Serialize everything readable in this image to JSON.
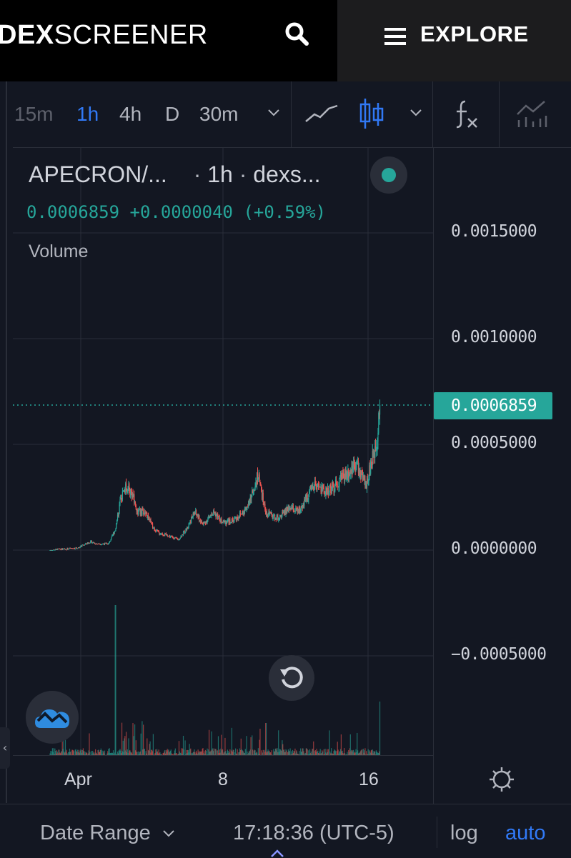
{
  "header": {
    "logo_bold": "DEX",
    "logo_light": "SCREENER",
    "explore_label": "EXPLORE"
  },
  "toolbar": {
    "timeframes": [
      "15m",
      "1h",
      "4h",
      "D",
      "30m"
    ],
    "active_timeframe": "1h"
  },
  "legend": {
    "symbol": "APECRON/...",
    "sep1": "·",
    "interval": "1h",
    "sep2": "·",
    "source": "dexs...",
    "price": "0.0006859",
    "change": "+0.0000040",
    "change_pct": "(+0.59%)",
    "volume_label": "Volume"
  },
  "price_axis": {
    "labels": [
      "0.0015000",
      "0.0010000",
      "0.0005000",
      "0.0000000",
      "−0.0005000"
    ],
    "current_price_tag": "0.0006859"
  },
  "time_axis": {
    "labels": [
      "Apr",
      "8",
      "16"
    ]
  },
  "bottom_bar": {
    "date_range_label": "Date Range",
    "clock": "17:18:36 (UTC-5)",
    "log_label": "log",
    "auto_label": "auto"
  },
  "colors": {
    "up": "#26a69a",
    "down": "#ef5350",
    "accent": "#3179f5",
    "background": "#131722"
  },
  "chart_data": {
    "type": "candlestick",
    "title": "APECRON/... · 1h · dexs...",
    "ylim": [
      -0.00085,
      0.0016
    ],
    "xlabel": "",
    "ylabel": "",
    "x_ticks": [
      "Apr",
      "8",
      "16"
    ],
    "last_price": 0.0006859,
    "price_path": [
      [
        0.0,
        0.0
      ],
      [
        2.0,
        1e-05
      ],
      [
        3.0,
        4e-05
      ],
      [
        3.4,
        3e-05
      ],
      [
        4.3,
        3e-05
      ],
      [
        4.8,
        0.0001
      ],
      [
        5.2,
        0.00025
      ],
      [
        5.6,
        0.0003
      ],
      [
        6.0,
        0.00027
      ],
      [
        6.4,
        0.00018
      ],
      [
        7.0,
        0.00018
      ],
      [
        7.6,
        0.0001
      ],
      [
        8.0,
        8e-05
      ],
      [
        8.6,
        7e-05
      ],
      [
        9.4,
        5e-05
      ],
      [
        10.0,
        0.0001
      ],
      [
        10.6,
        0.00018
      ],
      [
        11.2,
        0.00012
      ],
      [
        12.0,
        0.00018
      ],
      [
        12.6,
        0.00013
      ],
      [
        13.4,
        0.00014
      ],
      [
        14.0,
        0.00017
      ],
      [
        14.6,
        0.00022
      ],
      [
        15.2,
        0.00036
      ],
      [
        15.8,
        0.00018
      ],
      [
        16.6,
        0.00015
      ],
      [
        17.6,
        0.0002
      ],
      [
        18.2,
        0.00018
      ],
      [
        18.8,
        0.00025
      ],
      [
        19.4,
        0.0003
      ],
      [
        20.2,
        0.00028
      ],
      [
        20.8,
        0.0003
      ],
      [
        21.4,
        0.00035
      ],
      [
        22.0,
        0.00038
      ],
      [
        22.4,
        0.00042
      ],
      [
        22.8,
        0.00035
      ],
      [
        23.1,
        0.0003
      ],
      [
        23.4,
        0.00038
      ],
      [
        23.7,
        0.00045
      ],
      [
        24.0,
        0.00055
      ],
      [
        24.2,
        0.0006859
      ]
    ],
    "volume_notes": "volume histogram below price; largest spike near Apr 3, spike near Apr 10, spike at last bar"
  }
}
